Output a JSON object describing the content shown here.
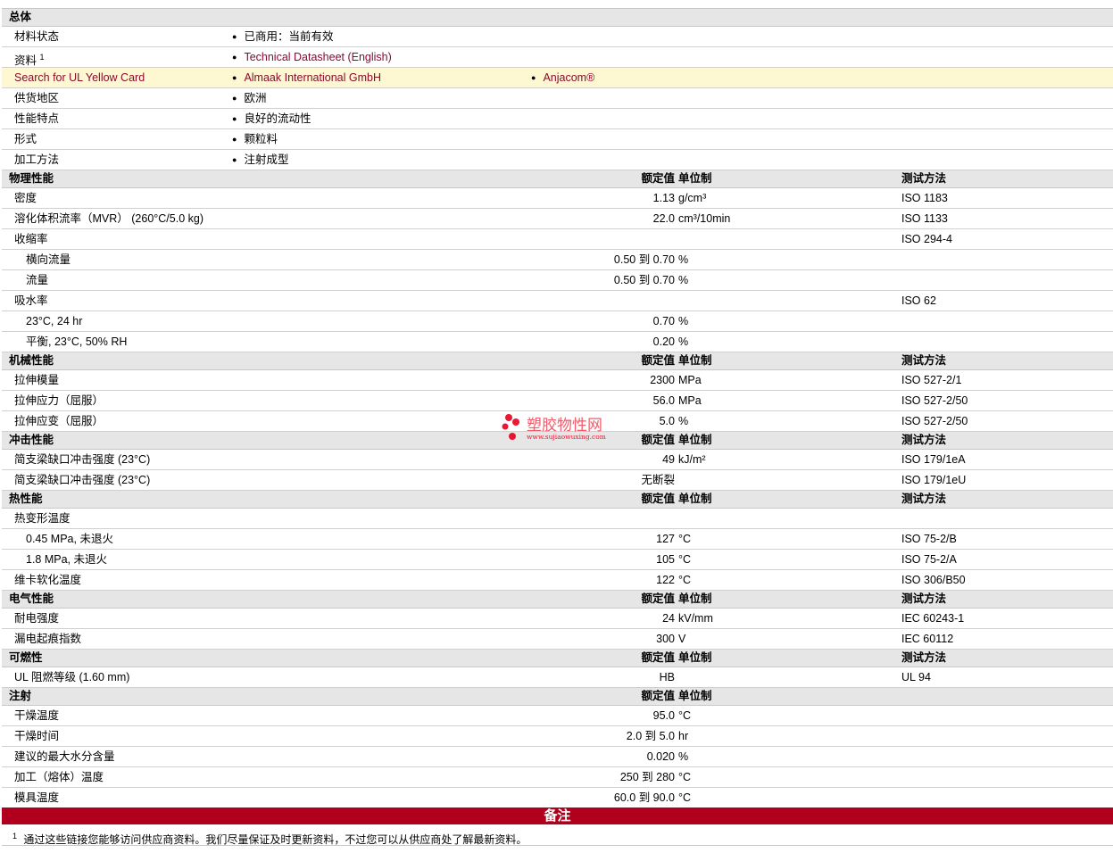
{
  "general": {
    "title": "总体",
    "rows": [
      {
        "label": "材料状态",
        "items": [
          "已商用：当前有效"
        ]
      },
      {
        "label": "资料",
        "sup": "1",
        "items": [
          "Technical Datasheet (English)"
        ],
        "link": true
      },
      {
        "label": "Search for UL Yellow Card",
        "items": [
          "Almaak International GmbH",
          "Anjacom®"
        ],
        "link": true,
        "highlight": true
      },
      {
        "label": "供货地区",
        "items": [
          "欧洲"
        ]
      },
      {
        "label": "性能特点",
        "items": [
          "良好的流动性"
        ]
      },
      {
        "label": "形式",
        "items": [
          "颗粒料"
        ]
      },
      {
        "label": "加工方法",
        "items": [
          "注射成型"
        ]
      }
    ]
  },
  "sections": [
    {
      "title": "物理性能",
      "val_h": "额定值",
      "unit_h": "单位制",
      "meth_h": "测试方法",
      "rows": [
        {
          "label": "密度",
          "value": "1.13",
          "unit": "g/cm³",
          "method": "ISO 1183"
        },
        {
          "label": "溶化体积流率（MVR） (260°C/5.0 kg)",
          "value": "22.0",
          "unit": "cm³/10min",
          "method": "ISO 1133"
        },
        {
          "label": "收缩率",
          "value": "",
          "unit": "",
          "method": "ISO 294-4"
        },
        {
          "label": "横向流量",
          "sub": true,
          "value": "0.50 到  0.70",
          "unit": "%",
          "method": ""
        },
        {
          "label": "流量",
          "sub": true,
          "value": "0.50 到  0.70",
          "unit": "%",
          "method": ""
        },
        {
          "label": "吸水率",
          "value": "",
          "unit": "",
          "method": "ISO 62"
        },
        {
          "label": "23°C, 24 hr",
          "sub": true,
          "value": "0.70",
          "unit": "%",
          "method": ""
        },
        {
          "label": "平衡, 23°C, 50% RH",
          "sub": true,
          "value": "0.20",
          "unit": "%",
          "method": ""
        }
      ]
    },
    {
      "title": "机械性能",
      "val_h": "额定值",
      "unit_h": "单位制",
      "meth_h": "测试方法",
      "rows": [
        {
          "label": "拉伸模量",
          "value": "2300",
          "unit": "MPa",
          "method": "ISO 527-2/1"
        },
        {
          "label": "拉伸应力（屈服）",
          "value": "56.0",
          "unit": "MPa",
          "method": "ISO 527-2/50"
        },
        {
          "label": "拉伸应变（屈服）",
          "value": "5.0",
          "unit": "%",
          "method": "ISO 527-2/50"
        }
      ]
    },
    {
      "title": "冲击性能",
      "val_h": "额定值",
      "unit_h": "单位制",
      "meth_h": "测试方法",
      "rows": [
        {
          "label": "简支梁缺口冲击强度 (23°C)",
          "value": "49",
          "unit": "kJ/m²",
          "method": "ISO 179/1eA"
        },
        {
          "label": "简支梁缺口冲击强度 (23°C)",
          "value": "无断裂",
          "unit": "",
          "method": "ISO 179/1eU"
        }
      ]
    },
    {
      "title": "热性能",
      "val_h": "额定值",
      "unit_h": "单位制",
      "meth_h": "测试方法",
      "rows": [
        {
          "label": "热变形温度",
          "value": "",
          "unit": "",
          "method": ""
        },
        {
          "label": "0.45 MPa, 未退火",
          "sub": true,
          "value": "127",
          "unit": "°C",
          "method": "ISO 75-2/B"
        },
        {
          "label": "1.8 MPa, 未退火",
          "sub": true,
          "value": "105",
          "unit": "°C",
          "method": "ISO 75-2/A"
        },
        {
          "label": "维卡软化温度",
          "value": "122",
          "unit": "°C",
          "method": "ISO 306/B50"
        }
      ]
    },
    {
      "title": "电气性能",
      "val_h": "额定值",
      "unit_h": "单位制",
      "meth_h": "测试方法",
      "rows": [
        {
          "label": "耐电强度",
          "value": "24",
          "unit": "kV/mm",
          "method": "IEC 60243-1"
        },
        {
          "label": "漏电起痕指数",
          "value": "300",
          "unit": "V",
          "method": "IEC 60112"
        }
      ]
    },
    {
      "title": "可燃性",
      "val_h": "额定值",
      "unit_h": "单位制",
      "meth_h": "测试方法",
      "rows": [
        {
          "label": "UL 阻燃等级 (1.60 mm)",
          "value": "HB",
          "unit": "",
          "method": "UL 94"
        }
      ]
    },
    {
      "title": "注射",
      "val_h": "额定值",
      "unit_h": "单位制",
      "meth_h": "",
      "rows": [
        {
          "label": "干燥温度",
          "value": "95.0",
          "unit": "°C",
          "method": ""
        },
        {
          "label": "干燥时间",
          "value": "2.0 到  5.0",
          "unit": "hr",
          "method": ""
        },
        {
          "label": "建议的最大水分含量",
          "value": "0.020",
          "unit": "%",
          "method": ""
        },
        {
          "label": "加工（熔体）温度",
          "value": "250 到  280",
          "unit": "°C",
          "method": ""
        },
        {
          "label": "模具温度",
          "value": "60.0 到  90.0",
          "unit": "°C",
          "method": ""
        }
      ]
    }
  ],
  "notes_title": "备注",
  "footnote": {
    "sup": "1",
    "text": "通过这些链接您能够访问供应商资料。我们尽量保证及时更新资料，不过您可以从供应商处了解最新资料。"
  },
  "watermark": {
    "name": "塑胶物性网",
    "url": "www.sujiaowuxing.com"
  }
}
